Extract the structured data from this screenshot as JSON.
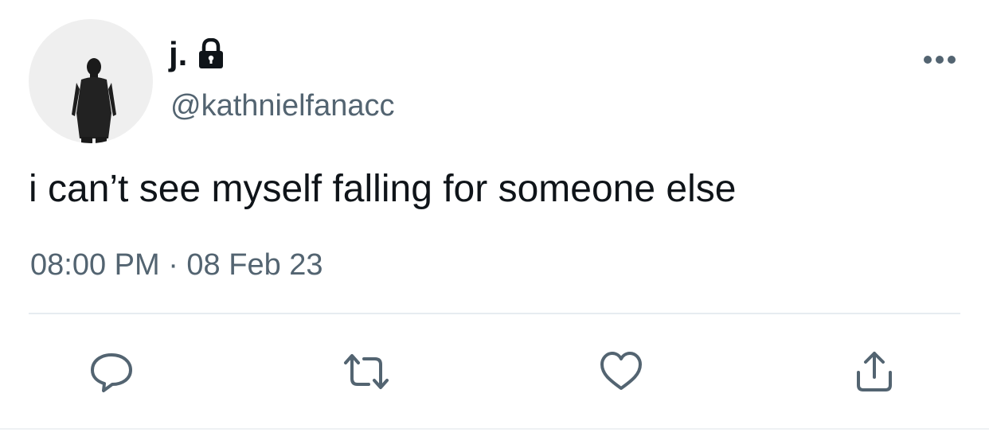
{
  "user": {
    "display_name": "j.",
    "handle": "@kathnielfanacc",
    "protected_icon": "lock-icon",
    "avatar_icon": "person-silhouette"
  },
  "tweet": {
    "text": "i can’t see myself falling for someone else",
    "timestamp": "08:00 PM · 08 Feb 23"
  },
  "actions": [
    {
      "name": "reply",
      "icon": "speech-bubble-icon"
    },
    {
      "name": "retweet",
      "icon": "retweet-icon"
    },
    {
      "name": "like",
      "icon": "heart-icon"
    },
    {
      "name": "share",
      "icon": "share-icon"
    }
  ],
  "menu_icon": "more-options-icon",
  "colors": {
    "text_primary": "#0f1419",
    "text_secondary": "#536471",
    "icon": "#536471",
    "divider": "#e6ecf0"
  }
}
